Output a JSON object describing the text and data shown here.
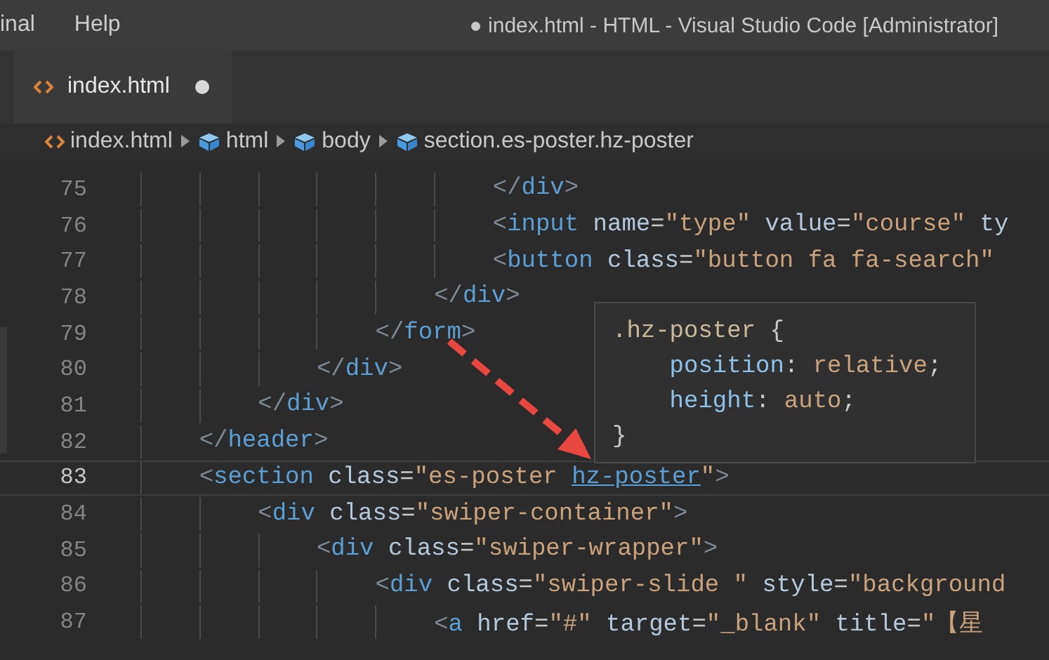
{
  "menu": [
    {
      "label": "inal"
    },
    {
      "label": "Help"
    }
  ],
  "window": {
    "title": "● index.html - HTML - Visual Studio Code [Administrator]"
  },
  "tabs": [
    {
      "label": "index.html",
      "selected": true,
      "modified": true
    }
  ],
  "breadcrumbs": [
    {
      "label": "index.html",
      "kind": "file"
    },
    {
      "label": "html",
      "kind": "element"
    },
    {
      "label": "body",
      "kind": "element"
    },
    {
      "label": "section.es-poster.hz-poster",
      "kind": "element"
    }
  ],
  "editor": {
    "lines": [
      {
        "number": "75",
        "current": false,
        "tokens": [
          {
            "kind": "punct",
            "text": "                        </"
          },
          {
            "kind": "tag",
            "text": "div"
          },
          {
            "kind": "punct",
            "text": ">"
          }
        ]
      },
      {
        "number": "76",
        "current": false,
        "tokens": [
          {
            "kind": "punct",
            "text": "                        <"
          },
          {
            "kind": "tag",
            "text": "input"
          },
          {
            "kind": "attr",
            "text": " name"
          },
          {
            "kind": "plain",
            "text": "="
          },
          {
            "kind": "string",
            "text": "\"type\""
          },
          {
            "kind": "attr",
            "text": " value"
          },
          {
            "kind": "plain",
            "text": "="
          },
          {
            "kind": "string",
            "text": "\"course\""
          },
          {
            "kind": "attr",
            "text": " ty"
          }
        ]
      },
      {
        "number": "77",
        "current": false,
        "tokens": [
          {
            "kind": "punct",
            "text": "                        <"
          },
          {
            "kind": "tag",
            "text": "button"
          },
          {
            "kind": "attr",
            "text": " class"
          },
          {
            "kind": "plain",
            "text": "="
          },
          {
            "kind": "string",
            "text": "\"button fa fa-search\""
          }
        ]
      },
      {
        "number": "78",
        "current": false,
        "tokens": [
          {
            "kind": "punct",
            "text": "                    </"
          },
          {
            "kind": "tag",
            "text": "div"
          },
          {
            "kind": "punct",
            "text": ">"
          }
        ]
      },
      {
        "number": "79",
        "current": false,
        "tokens": [
          {
            "kind": "punct",
            "text": "                </"
          },
          {
            "kind": "tag",
            "text": "form"
          },
          {
            "kind": "punct",
            "text": ">"
          }
        ]
      },
      {
        "number": "80",
        "current": false,
        "tokens": [
          {
            "kind": "punct",
            "text": "            </"
          },
          {
            "kind": "tag",
            "text": "div"
          },
          {
            "kind": "punct",
            "text": ">"
          }
        ]
      },
      {
        "number": "81",
        "current": false,
        "tokens": [
          {
            "kind": "punct",
            "text": "        </"
          },
          {
            "kind": "tag",
            "text": "div"
          },
          {
            "kind": "punct",
            "text": ">"
          }
        ]
      },
      {
        "number": "82",
        "current": false,
        "tokens": [
          {
            "kind": "punct",
            "text": "    </"
          },
          {
            "kind": "tag",
            "text": "header"
          },
          {
            "kind": "punct",
            "text": ">"
          }
        ]
      },
      {
        "number": "83",
        "current": true,
        "tokens": [
          {
            "kind": "punct",
            "text": "    <"
          },
          {
            "kind": "tag",
            "text": "section"
          },
          {
            "kind": "attr",
            "text": " class"
          },
          {
            "kind": "plain",
            "text": "="
          },
          {
            "kind": "string",
            "text": "\"es-poster "
          },
          {
            "kind": "link",
            "text": "hz-poster"
          },
          {
            "kind": "string",
            "text": "\""
          },
          {
            "kind": "punct",
            "text": ">"
          }
        ]
      },
      {
        "number": "84",
        "current": false,
        "tokens": [
          {
            "kind": "punct",
            "text": "        <"
          },
          {
            "kind": "tag",
            "text": "div"
          },
          {
            "kind": "attr",
            "text": " class"
          },
          {
            "kind": "plain",
            "text": "="
          },
          {
            "kind": "string",
            "text": "\"swiper-container\""
          },
          {
            "kind": "punct",
            "text": ">"
          }
        ]
      },
      {
        "number": "85",
        "current": false,
        "tokens": [
          {
            "kind": "punct",
            "text": "            <"
          },
          {
            "kind": "tag",
            "text": "div"
          },
          {
            "kind": "attr",
            "text": " class"
          },
          {
            "kind": "plain",
            "text": "="
          },
          {
            "kind": "string",
            "text": "\"swiper-wrapper\""
          },
          {
            "kind": "punct",
            "text": ">"
          }
        ]
      },
      {
        "number": "86",
        "current": false,
        "tokens": [
          {
            "kind": "punct",
            "text": "                <"
          },
          {
            "kind": "tag",
            "text": "div"
          },
          {
            "kind": "attr",
            "text": " class"
          },
          {
            "kind": "plain",
            "text": "="
          },
          {
            "kind": "string",
            "text": "\"swiper-slide \""
          },
          {
            "kind": "attr",
            "text": " style"
          },
          {
            "kind": "plain",
            "text": "="
          },
          {
            "kind": "string",
            "text": "\"background"
          }
        ]
      },
      {
        "number": "87",
        "current": false,
        "tokens": [
          {
            "kind": "punct",
            "text": "                    <"
          },
          {
            "kind": "tag",
            "text": "a"
          },
          {
            "kind": "attr",
            "text": " href"
          },
          {
            "kind": "plain",
            "text": "="
          },
          {
            "kind": "string",
            "text": "\"#\""
          },
          {
            "kind": "attr",
            "text": " target"
          },
          {
            "kind": "plain",
            "text": "="
          },
          {
            "kind": "string",
            "text": "\"_blank\""
          },
          {
            "kind": "attr",
            "text": " title"
          },
          {
            "kind": "plain",
            "text": "="
          },
          {
            "kind": "string",
            "text": "\"【星"
          }
        ]
      }
    ]
  },
  "hover": {
    "lines": [
      {
        "tokens": [
          {
            "kind": "selector",
            "text": ".hz-poster"
          },
          {
            "kind": "plain",
            "text": " {"
          }
        ]
      },
      {
        "tokens": [
          {
            "kind": "property",
            "text": "    position"
          },
          {
            "kind": "plain",
            "text": ":"
          },
          {
            "kind": "value",
            "text": " relative"
          },
          {
            "kind": "plain",
            "text": ";"
          }
        ]
      },
      {
        "tokens": [
          {
            "kind": "property",
            "text": "    height"
          },
          {
            "kind": "plain",
            "text": ":"
          },
          {
            "kind": "value",
            "text": " auto"
          },
          {
            "kind": "plain",
            "text": ";"
          }
        ]
      },
      {
        "tokens": [
          {
            "kind": "plain",
            "text": "}"
          }
        ]
      }
    ]
  }
}
